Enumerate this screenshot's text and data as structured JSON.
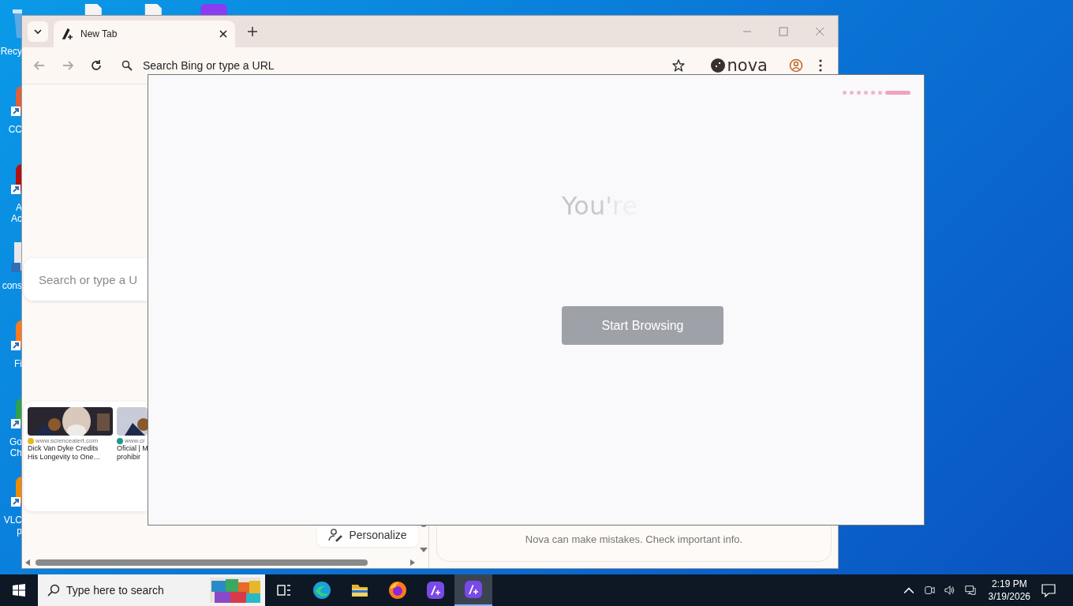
{
  "desktop": {
    "icons": [
      {
        "kind": "recycle-bin",
        "color": "#5aa9e6",
        "lines": [
          "Recy"
        ]
      },
      {
        "kind": "shortcut",
        "color": "#e0603a",
        "lines": [
          "CC"
        ]
      },
      {
        "kind": "shortcut",
        "color": "#b01010",
        "lines": [
          "A",
          "Ac"
        ]
      },
      {
        "kind": "document",
        "color": "#e8e8e8",
        "lines": [
          "cons"
        ]
      },
      {
        "kind": "shortcut",
        "color": "#ff7a1a",
        "lines": [
          "Fi"
        ]
      },
      {
        "kind": "shortcut",
        "color": "#2ea24a",
        "lines": [
          "Go",
          "Ch"
        ]
      },
      {
        "kind": "shortcut",
        "color": "#f08a00",
        "lines": [
          "VLC",
          "p"
        ]
      }
    ],
    "top_icons": [
      {
        "kind": "document"
      },
      {
        "kind": "document"
      },
      {
        "kind": "app"
      }
    ]
  },
  "browser": {
    "tabs": [
      {
        "title": "New Tab",
        "selected": true
      }
    ],
    "nav": [
      {
        "kind": "back",
        "disabled": true
      },
      {
        "kind": "forward",
        "disabled": true
      },
      {
        "kind": "reload",
        "disabled": false
      }
    ],
    "address": {
      "placeholder": "Search Bing or type a URL"
    },
    "brand": "nova",
    "new_tab": {
      "search": {
        "placeholder": "Search or type a U"
      },
      "news": [
        {
          "source": "www.sciencealert.com",
          "color": "#e8b820",
          "headline": [
            "Dick Van Dyke Credits",
            "His Longevity to One…"
          ]
        },
        {
          "source": "www.cr",
          "color": "#1a9a8a",
          "headline": [
            "Oficial | M",
            "prohibir"
          ]
        }
      ],
      "personalize": "Personalize"
    },
    "disclaimer": "Nova can make mistakes. Check important info."
  },
  "onboarding": {
    "heading": "You're",
    "button": "Start Browsing",
    "steps": [
      {
        "selected": false
      },
      {
        "selected": false
      },
      {
        "selected": false
      },
      {
        "selected": false
      },
      {
        "selected": false
      },
      {
        "selected": false
      },
      {
        "selected": true
      }
    ]
  },
  "taskbar": {
    "search": {
      "placeholder": "Type here to search"
    },
    "apps": [
      {
        "kind": "task-view",
        "selected": false
      },
      {
        "kind": "edge",
        "selected": false
      },
      {
        "kind": "explorer",
        "selected": false
      },
      {
        "kind": "firefox",
        "selected": false
      },
      {
        "kind": "nova",
        "selected": false
      },
      {
        "kind": "nova",
        "selected": true
      }
    ],
    "clock": {
      "time": "2:19 PM",
      "date": "3/19/2026"
    }
  }
}
